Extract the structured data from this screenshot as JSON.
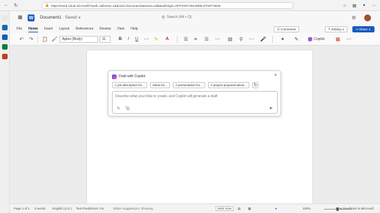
{
  "browser": {
    "url": "https://word.cloud.microsoft/?auth=1&home=1&docId=Document1&action=edit&wdOrigin=OFFICECOM-WEB.START.NEW",
    "icons": [
      "back-icon",
      "refresh-icon",
      "lock-icon",
      "star-icon",
      "extensions-icon",
      "profile-icon",
      "more-icon"
    ]
  },
  "titlebar": {
    "app_letter": "W",
    "doc_name": "Document1",
    "saved_status": " · Saved ∨",
    "search_placeholder": "Search (Alt + Q)"
  },
  "ribbon": {
    "tabs": [
      "File",
      "Home",
      "Insert",
      "Layout",
      "References",
      "Review",
      "View",
      "Help"
    ],
    "active_tab": "Home",
    "right": {
      "comments": "☰ Comments",
      "editing": "✎ Editing ∨",
      "share": "↪ Share ∨"
    }
  },
  "toolbar": {
    "font_name": "Aptos (Body)",
    "font_size": "11",
    "bold": "B",
    "italic": "I",
    "underline": "U",
    "copilot_label": "Copilot"
  },
  "copilot": {
    "title": "Draft with Copilot",
    "chips": [
      "A job description for...",
      "Ideas for...",
      "A presentation for...",
      "A project proposal about..."
    ],
    "prompt_placeholder": "Describe what you'd like to create, and Copilot will generate a draft"
  },
  "statusbar": {
    "page": "Page 1 of 1",
    "words": "0 words",
    "language": "English (U.S.)",
    "text_predictions": "Text Predictions: On",
    "editor_suggestions": "Editor Suggestions: Showing",
    "view_mode": "Web View",
    "zoom": "100%",
    "feedback": "Give Feedback to Microsoft"
  },
  "colors": {
    "word_blue": "#185abd",
    "outlook_blue": "#0f6cbd",
    "excel_green": "#107c41",
    "powerpoint_red": "#c43e1c"
  }
}
